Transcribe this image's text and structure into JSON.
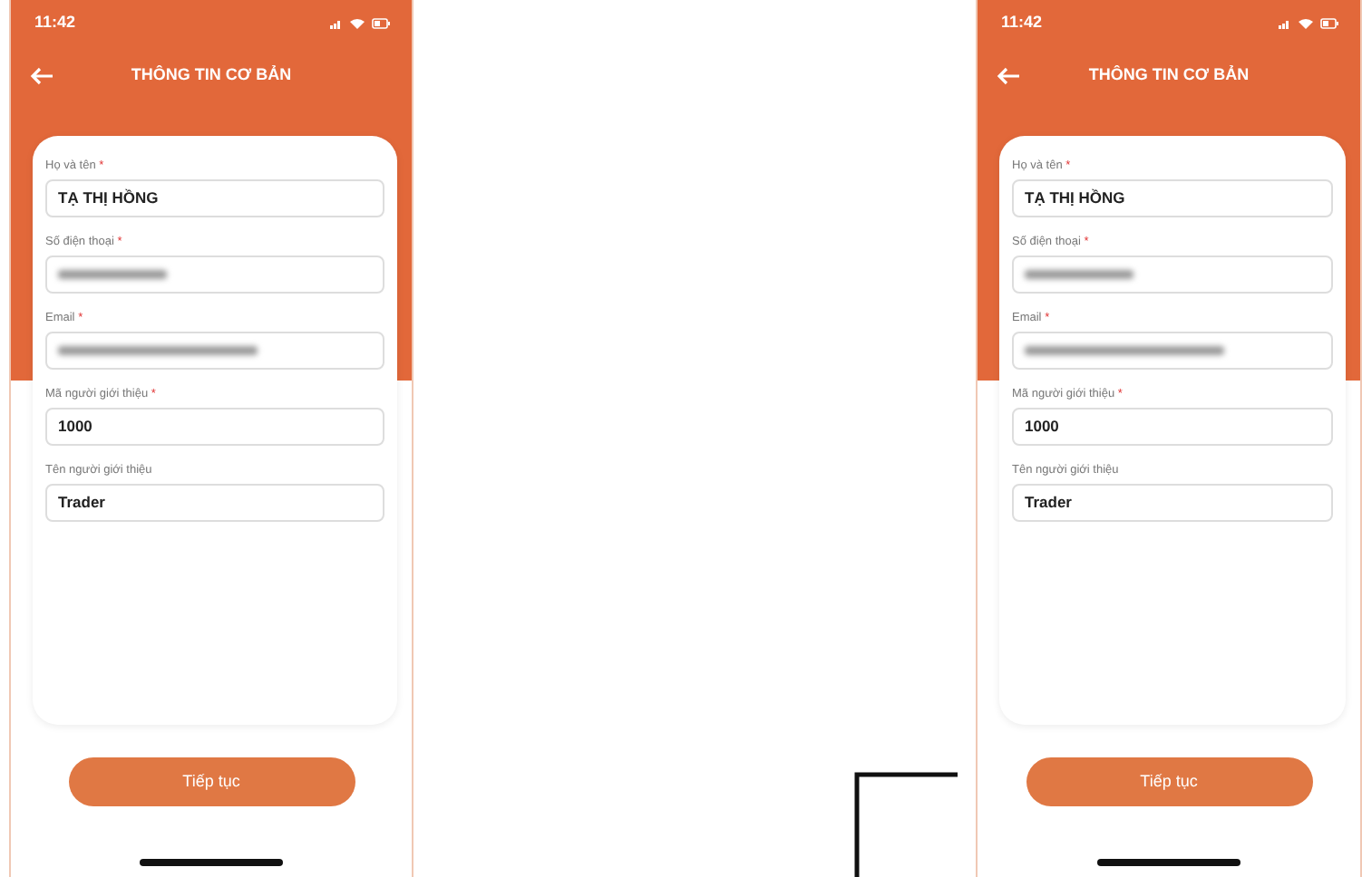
{
  "screens": [
    {
      "status_time": "11:42",
      "title": "THÔNG TIN CƠ BẢN",
      "fields": [
        {
          "label": "Họ và tên",
          "required_mark": "*",
          "value": "TẠ THỊ HỒNG",
          "redacted": false
        },
        {
          "label": "Số điện thoại",
          "required_mark": "*",
          "redacted": true
        },
        {
          "label": "Email",
          "required_mark": "*",
          "redacted": true
        },
        {
          "label": "Mã người giới thiệu",
          "required_mark": "*",
          "value": "1000",
          "redacted": false
        },
        {
          "label": "Tên người giới thiệu",
          "value": "Trader",
          "redacted": false
        }
      ],
      "button": "Tiếp tục"
    },
    {
      "status_time": "11:42",
      "title": "THÔNG TIN CƠ BẢN",
      "fields": [
        {
          "label": "Họ và tên",
          "required_mark": "*",
          "value": "TẠ THỊ HỒNG",
          "redacted": false
        },
        {
          "label": "Số điện thoại",
          "required_mark": "*",
          "redacted": true
        },
        {
          "label": "Email",
          "required_mark": "*",
          "redacted": true
        },
        {
          "label": "Mã người giới thiệu",
          "required_mark": "*",
          "value": "1000",
          "redacted": false
        },
        {
          "label": "Tên người giới thiệu",
          "value": "Trader",
          "redacted": false
        }
      ],
      "button": "Tiếp tục"
    }
  ]
}
